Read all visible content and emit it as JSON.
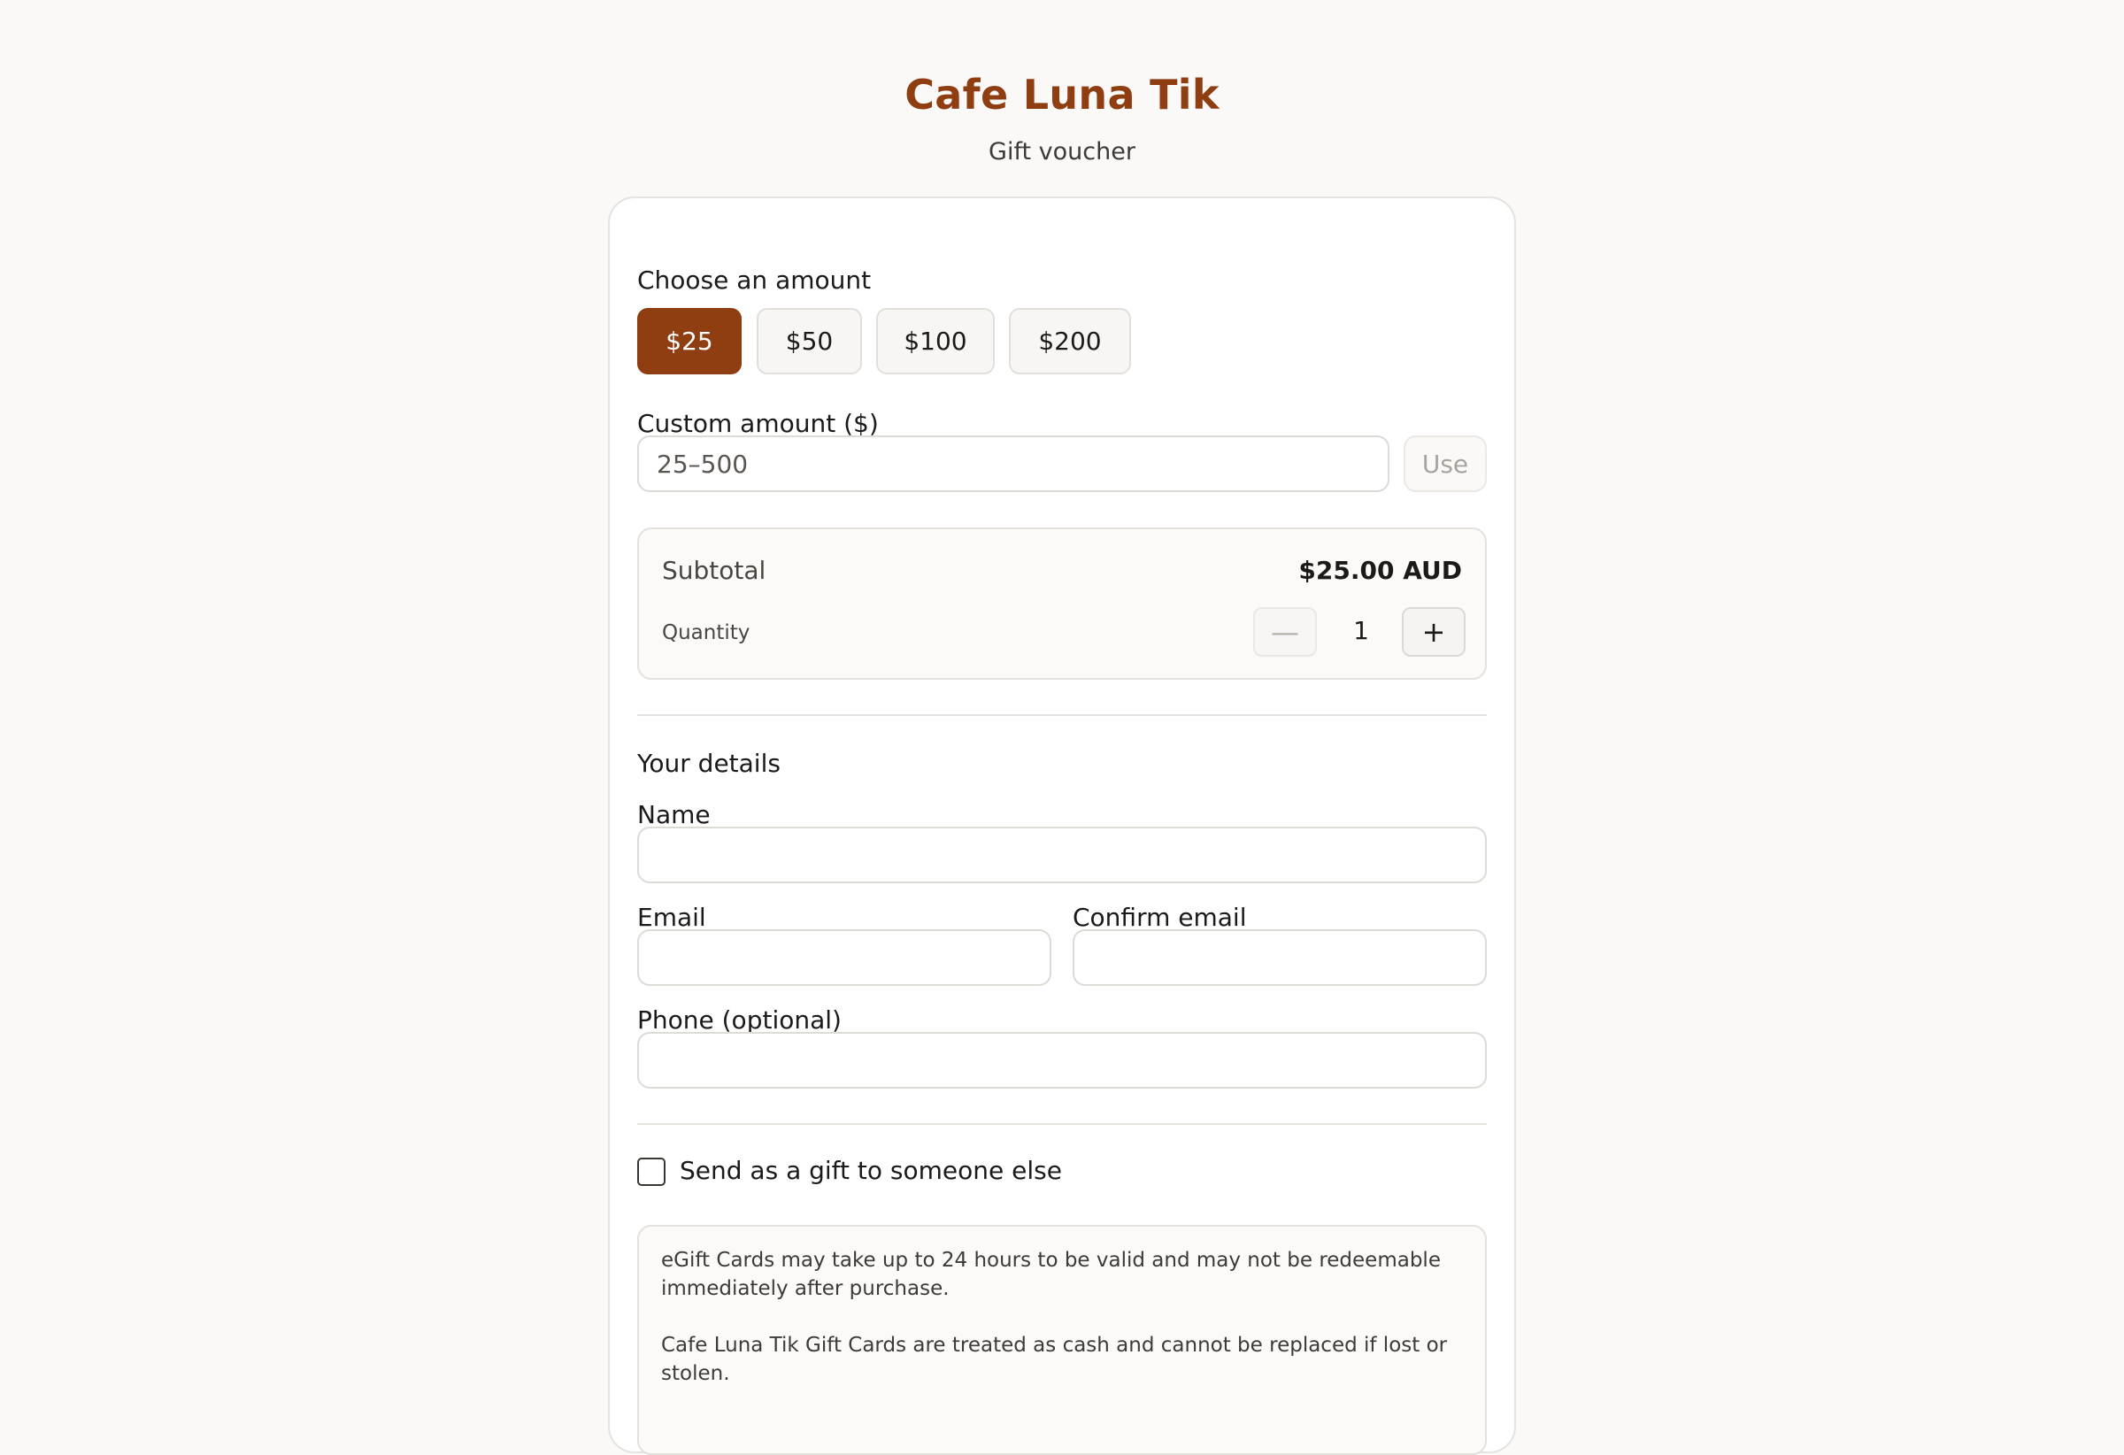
{
  "header": {
    "brand": "Cafe Luna Tik",
    "tagline": "Gift voucher"
  },
  "amount": {
    "label": "Choose an amount",
    "options": [
      "$25",
      "$50",
      "$100",
      "$200"
    ],
    "selected": "$25",
    "accent_color": "#8f3e12"
  },
  "custom": {
    "label": "Custom amount ($)",
    "placeholder": "25–500",
    "use_label": "Use"
  },
  "summary": {
    "subtotal_label": "Subtotal",
    "subtotal_value": "$25.00 AUD",
    "quantity_label": "Quantity",
    "quantity_value": "1",
    "minus_icon": "minus-icon",
    "plus_icon": "plus-icon"
  },
  "details": {
    "heading": "Your details",
    "name_label": "Name",
    "email_label": "Email",
    "confirm_email_label": "Confirm email",
    "phone_label": "Phone (optional)"
  },
  "gift": {
    "checkbox_label": "Send as a gift to someone else",
    "checked": false
  },
  "notice": {
    "line1": "eGift Cards may take up to 24 hours to be valid and may not be redeemable immediately after purchase.",
    "line2": "Cafe Luna Tik Gift Cards are treated as cash and cannot be replaced if lost or stolen."
  }
}
